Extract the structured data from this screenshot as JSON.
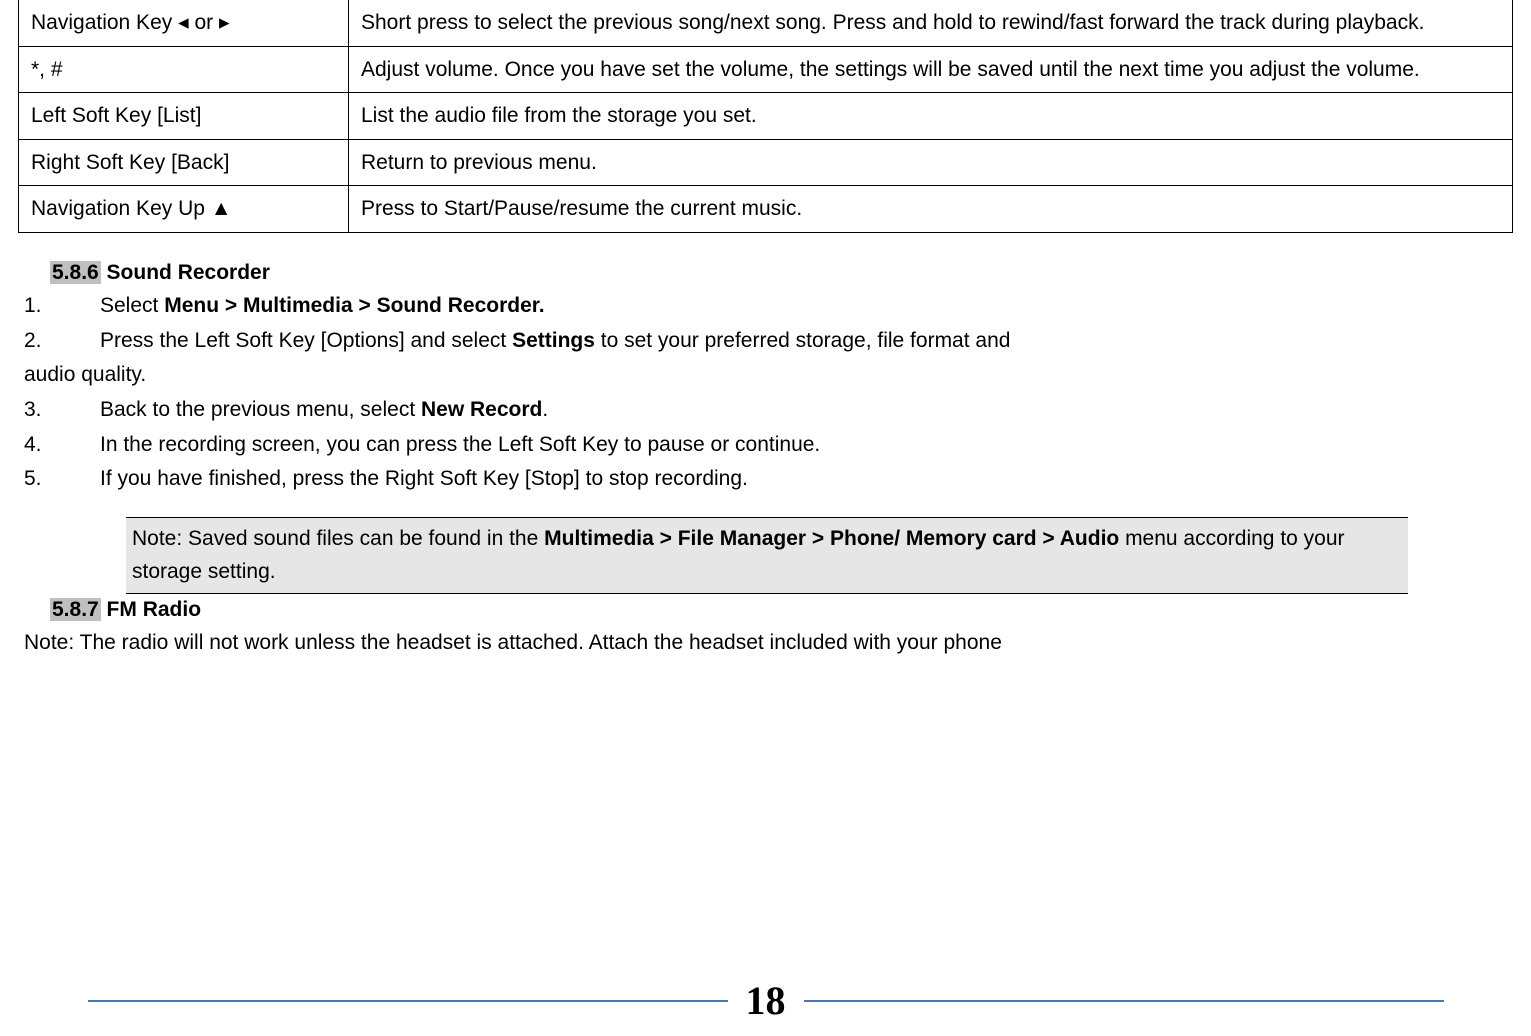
{
  "table": {
    "rows": [
      {
        "key": "Navigation Key ◂ or ▸",
        "desc": "Short press to select the previous song/next song. Press and hold to rewind/fast forward the track during playback."
      },
      {
        "key": "*, #",
        "desc": "Adjust volume. Once you have set the volume, the settings will be saved until the next time you adjust the volume."
      },
      {
        "key": "Left Soft Key [List]",
        "desc": "List the audio file from the storage you set."
      },
      {
        "key": "Right Soft Key [Back]",
        "desc": "Return to previous menu."
      },
      {
        "key": "Navigation Key Up ▲",
        "desc": "Press to Start/Pause/resume the current music."
      }
    ]
  },
  "section586": {
    "num": "5.8.6",
    "title": " Sound Recorder",
    "step1_num": "1.",
    "step1_a": "Select ",
    "step1_b": "Menu > Multimedia > Sound Recorder.",
    "step2_num": "2.",
    "step2_a": "Press the Left Soft Key [Options] and select ",
    "step2_b": "Settings",
    "step2_c": " to set your preferred storage, file format and",
    "step2_wrap": "audio quality.",
    "step3_num": "3.",
    "step3_a": "Back to the previous menu, select ",
    "step3_b": "New Record",
    "step3_c": ".",
    "step4_num": "4.",
    "step4": "In the recording screen, you can press the Left Soft Key to pause or continue.",
    "step5_num": "5.",
    "step5": "If you have finished, press the Right Soft Key [Stop] to stop recording."
  },
  "note": {
    "a": "Note: Saved sound files can be found in the ",
    "b": "Multimedia > File Manager > Phone/ Memory card > Audio",
    "c": " menu according to your storage setting."
  },
  "section587": {
    "num": "5.8.7",
    "title": " FM Radio",
    "body": "Note: The radio will not work unless the headset is attached. Attach the headset included with your phone"
  },
  "page_number": "18"
}
